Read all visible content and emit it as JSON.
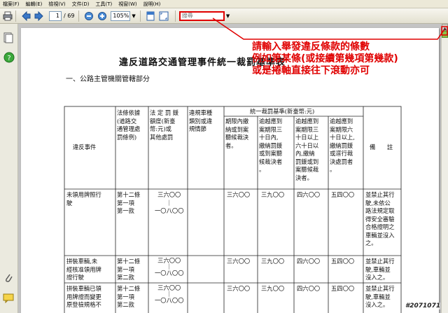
{
  "menu": [
    "檔案(F)",
    "編輯(E)",
    "檢視(V)",
    "文件(D)",
    "工具(T)",
    "視窗(W)",
    "說明(H)"
  ],
  "toolbar": {
    "page_current": "1",
    "page_total": "/ 69",
    "zoom": "105%",
    "search_placeholder": "搜尋"
  },
  "annotation": {
    "lines": [
      "請輸入舉發違反條款的條數",
      "例如第某條(或接續第幾項第幾款)",
      "或是捲軸直接往下滾動亦可"
    ],
    "color": "#e00000"
  },
  "document": {
    "title": "違反道路交通管理事件統一裁罰基準表",
    "section": "一、公路主管機關管轄部分",
    "headers": {
      "violation": "違反事件",
      "legal": "法條依據\n(道路交\n通管理處\n罰條例)",
      "statutory": "法 定 罰 鍰\n額度(新臺\n幣:元)或\n其他處罰",
      "vehicle": "違規車種\n類別或違\n規情節",
      "unified": "統一裁罰基準(新臺幣:元)",
      "sub1": "期限內繳\n納或到案\n聽候裁決\n者。",
      "sub2": "逾越應到\n案期限三\n十日內,\n繳納罰鍰\n或到案聽\n候裁決者\n。",
      "sub3": "逾越應到\n案期限三\n十日以上\n六十日以\n內,繳納\n罰鍰或到\n案聽候裁\n決者。",
      "sub4": "逾越應到\n案期限六\n十日以上,\n繳納罰鍰\n或逕行裁\n決處罰者\n。",
      "remark": "備　　註"
    },
    "rows": [
      {
        "violation": "未領用牌照行\n駛",
        "legal": "第十二條\n第一項\n第一款",
        "statutory": "三六〇〇\n｜\n一〇八〇〇",
        "v1": "三六〇〇",
        "v2": "三九〇〇",
        "v3": "四六〇〇",
        "v4": "五四〇〇",
        "remark": "並禁止其行\n駛,未依公\n路法規定取\n得安全審驗\n合格證明之\n車輛並沒入\n之。"
      },
      {
        "violation": "拼裝車輛,未\n經核准領用牌\n證行駛",
        "legal": "第十二條\n第一項\n第二款",
        "statutory": "三六〇〇\n｜\n一〇八〇〇",
        "v1": "三六〇〇",
        "v2": "三九〇〇",
        "v3": "四六〇〇",
        "v4": "五四〇〇",
        "remark": "並禁止其行\n駛,車輛並\n沒入之。"
      },
      {
        "violation": "拼裝車輛已領\n用牌證而變更\n原登檢規格不",
        "legal": "第十二條\n第一項\n第二款",
        "statutory": "三六〇〇\n｜\n一〇八〇〇",
        "v1": "三六〇〇",
        "v2": "三九〇〇",
        "v3": "四六〇〇",
        "v4": "五四〇〇",
        "remark": "並禁止其行\n駛,車輛並\n沒入之。"
      }
    ]
  },
  "watermark": "#2071071"
}
